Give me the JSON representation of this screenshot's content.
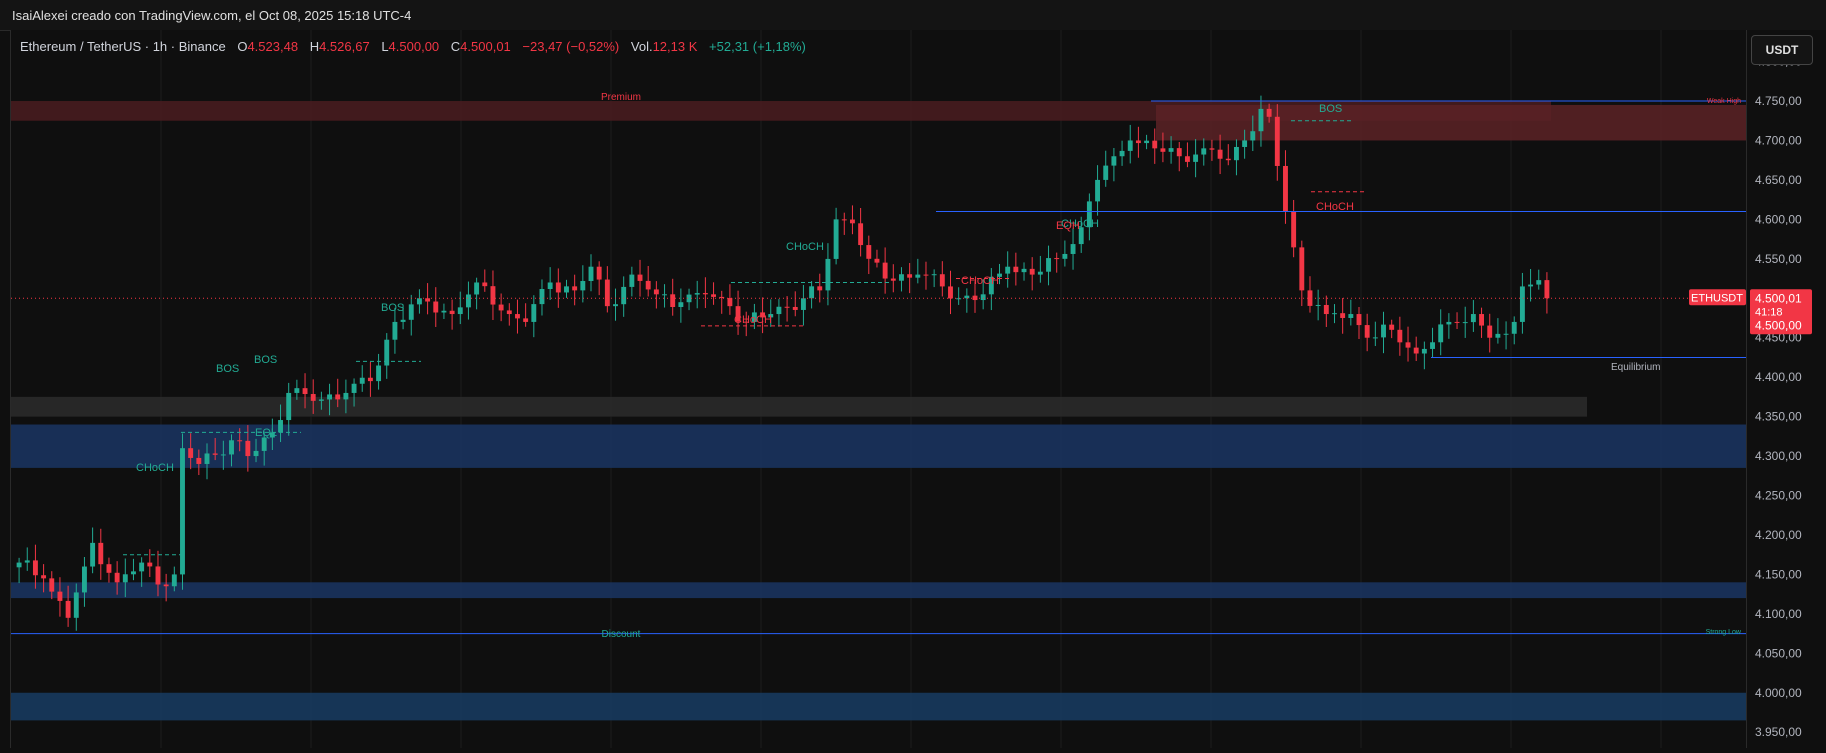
{
  "header": {
    "title": "IsaiAlexei creado con TradingView.com, el Oct 08, 2025 15:18 UTC-4"
  },
  "legend": {
    "symbol": "Ethereum / TetherUS · 1h · Binance",
    "open_label": "O",
    "open": "4.523,48",
    "high_label": "H",
    "high": "4.526,67",
    "low_label": "L",
    "low": "4.500,00",
    "close_label": "C",
    "close": "4.500,01",
    "change": "−23,47 (−0,52%)",
    "vol_label": "Vol.",
    "vol": "12,13 K",
    "vol_change": "+52,31 (+1,18%)"
  },
  "currency_button": "USDT",
  "colors": {
    "up": "#22ab94",
    "down": "#f23645",
    "zone_blue": "#1e3a6e",
    "zone_red": "#5a1e22",
    "eq_zone": "#2e2e2e"
  },
  "axis": {
    "ticks": [
      "4.800,00",
      "4.750,00",
      "4.700,00",
      "4.650,00",
      "4.600,00",
      "4.550,00",
      "4.450,00",
      "4.400,00",
      "4.350,00",
      "4.300,00",
      "4.250,00",
      "4.200,00",
      "4.150,00",
      "4.100,00",
      "4.050,00",
      "4.000,00",
      "3.950,00"
    ],
    "price_tag": {
      "symbol": "ETHUSDT",
      "price": "4.500,01",
      "countdown": "41:18",
      "low": "4.500,00"
    }
  },
  "annotations": {
    "premium": "Premium",
    "discount": "Discount",
    "equilibrium": "Equilibrium",
    "weak": "Weak High",
    "strong": "Strong Low",
    "bos": "BOS",
    "choch": "CHoCH",
    "eql": "EQL",
    "eqh": "EQH"
  },
  "chart_data": {
    "type": "candlestick",
    "title": "Ethereum / TetherUS · 1h · Binance",
    "ylim": [
      3930,
      4840
    ],
    "y_ticks": [
      3950,
      4000,
      4050,
      4100,
      4150,
      4200,
      4250,
      4300,
      4350,
      4400,
      4450,
      4500,
      4550,
      4600,
      4650,
      4700,
      4750,
      4800
    ],
    "last_price": 4500.01,
    "waypoints": [
      [
        0,
        4165
      ],
      [
        3,
        4145
      ],
      [
        6,
        4095
      ],
      [
        8,
        4160
      ],
      [
        9,
        4190
      ],
      [
        12,
        4140
      ],
      [
        15,
        4165
      ],
      [
        18,
        4135
      ],
      [
        19,
        4150
      ],
      [
        20,
        4310
      ],
      [
        22,
        4290
      ],
      [
        26,
        4320
      ],
      [
        28,
        4300
      ],
      [
        31,
        4330
      ],
      [
        33,
        4380
      ],
      [
        36,
        4370
      ],
      [
        40,
        4380
      ],
      [
        43,
        4395
      ],
      [
        46,
        4470
      ],
      [
        49,
        4500
      ],
      [
        53,
        4480
      ],
      [
        56,
        4520
      ],
      [
        60,
        4480
      ],
      [
        62,
        4470
      ],
      [
        65,
        4520
      ],
      [
        68,
        4510
      ],
      [
        70,
        4540
      ],
      [
        72,
        4490
      ],
      [
        75,
        4530
      ],
      [
        78,
        4505
      ],
      [
        81,
        4495
      ],
      [
        84,
        4505
      ],
      [
        87,
        4490
      ],
      [
        89,
        4470
      ],
      [
        92,
        4480
      ],
      [
        96,
        4500
      ],
      [
        98,
        4510
      ],
      [
        100,
        4600
      ],
      [
        102,
        4595
      ],
      [
        104,
        4550
      ],
      [
        106,
        4525
      ],
      [
        110,
        4530
      ],
      [
        113,
        4515
      ],
      [
        115,
        4500
      ],
      [
        118,
        4505
      ],
      [
        121,
        4540
      ],
      [
        124,
        4530
      ],
      [
        127,
        4550
      ],
      [
        130,
        4590
      ],
      [
        132,
        4650
      ],
      [
        134,
        4680
      ],
      [
        136,
        4700
      ],
      [
        139,
        4690
      ],
      [
        142,
        4680
      ],
      [
        145,
        4690
      ],
      [
        148,
        4675
      ],
      [
        150,
        4700
      ],
      [
        152,
        4740
      ],
      [
        153,
        4730
      ],
      [
        155,
        4610
      ],
      [
        157,
        4510
      ],
      [
        160,
        4480
      ],
      [
        163,
        4480
      ],
      [
        165,
        4450
      ],
      [
        168,
        4460
      ],
      [
        171,
        4430
      ],
      [
        175,
        4470
      ],
      [
        178,
        4480
      ],
      [
        180,
        4450
      ],
      [
        182,
        4455
      ],
      [
        183,
        4470
      ],
      [
        184,
        4515
      ],
      [
        186,
        4523
      ],
      [
        187,
        4500.01
      ]
    ],
    "zones": [
      {
        "kind": "premium",
        "top": 4750,
        "bottom": 4725
      },
      {
        "kind": "supply",
        "top": 4745,
        "bottom": 4700
      },
      {
        "kind": "equilibrium",
        "top": 4375,
        "bottom": 4350
      },
      {
        "kind": "demand",
        "top": 4340,
        "bottom": 4285
      },
      {
        "kind": "demand",
        "top": 4140,
        "bottom": 4120
      },
      {
        "kind": "discount",
        "top": 4000,
        "bottom": 3965
      }
    ]
  }
}
